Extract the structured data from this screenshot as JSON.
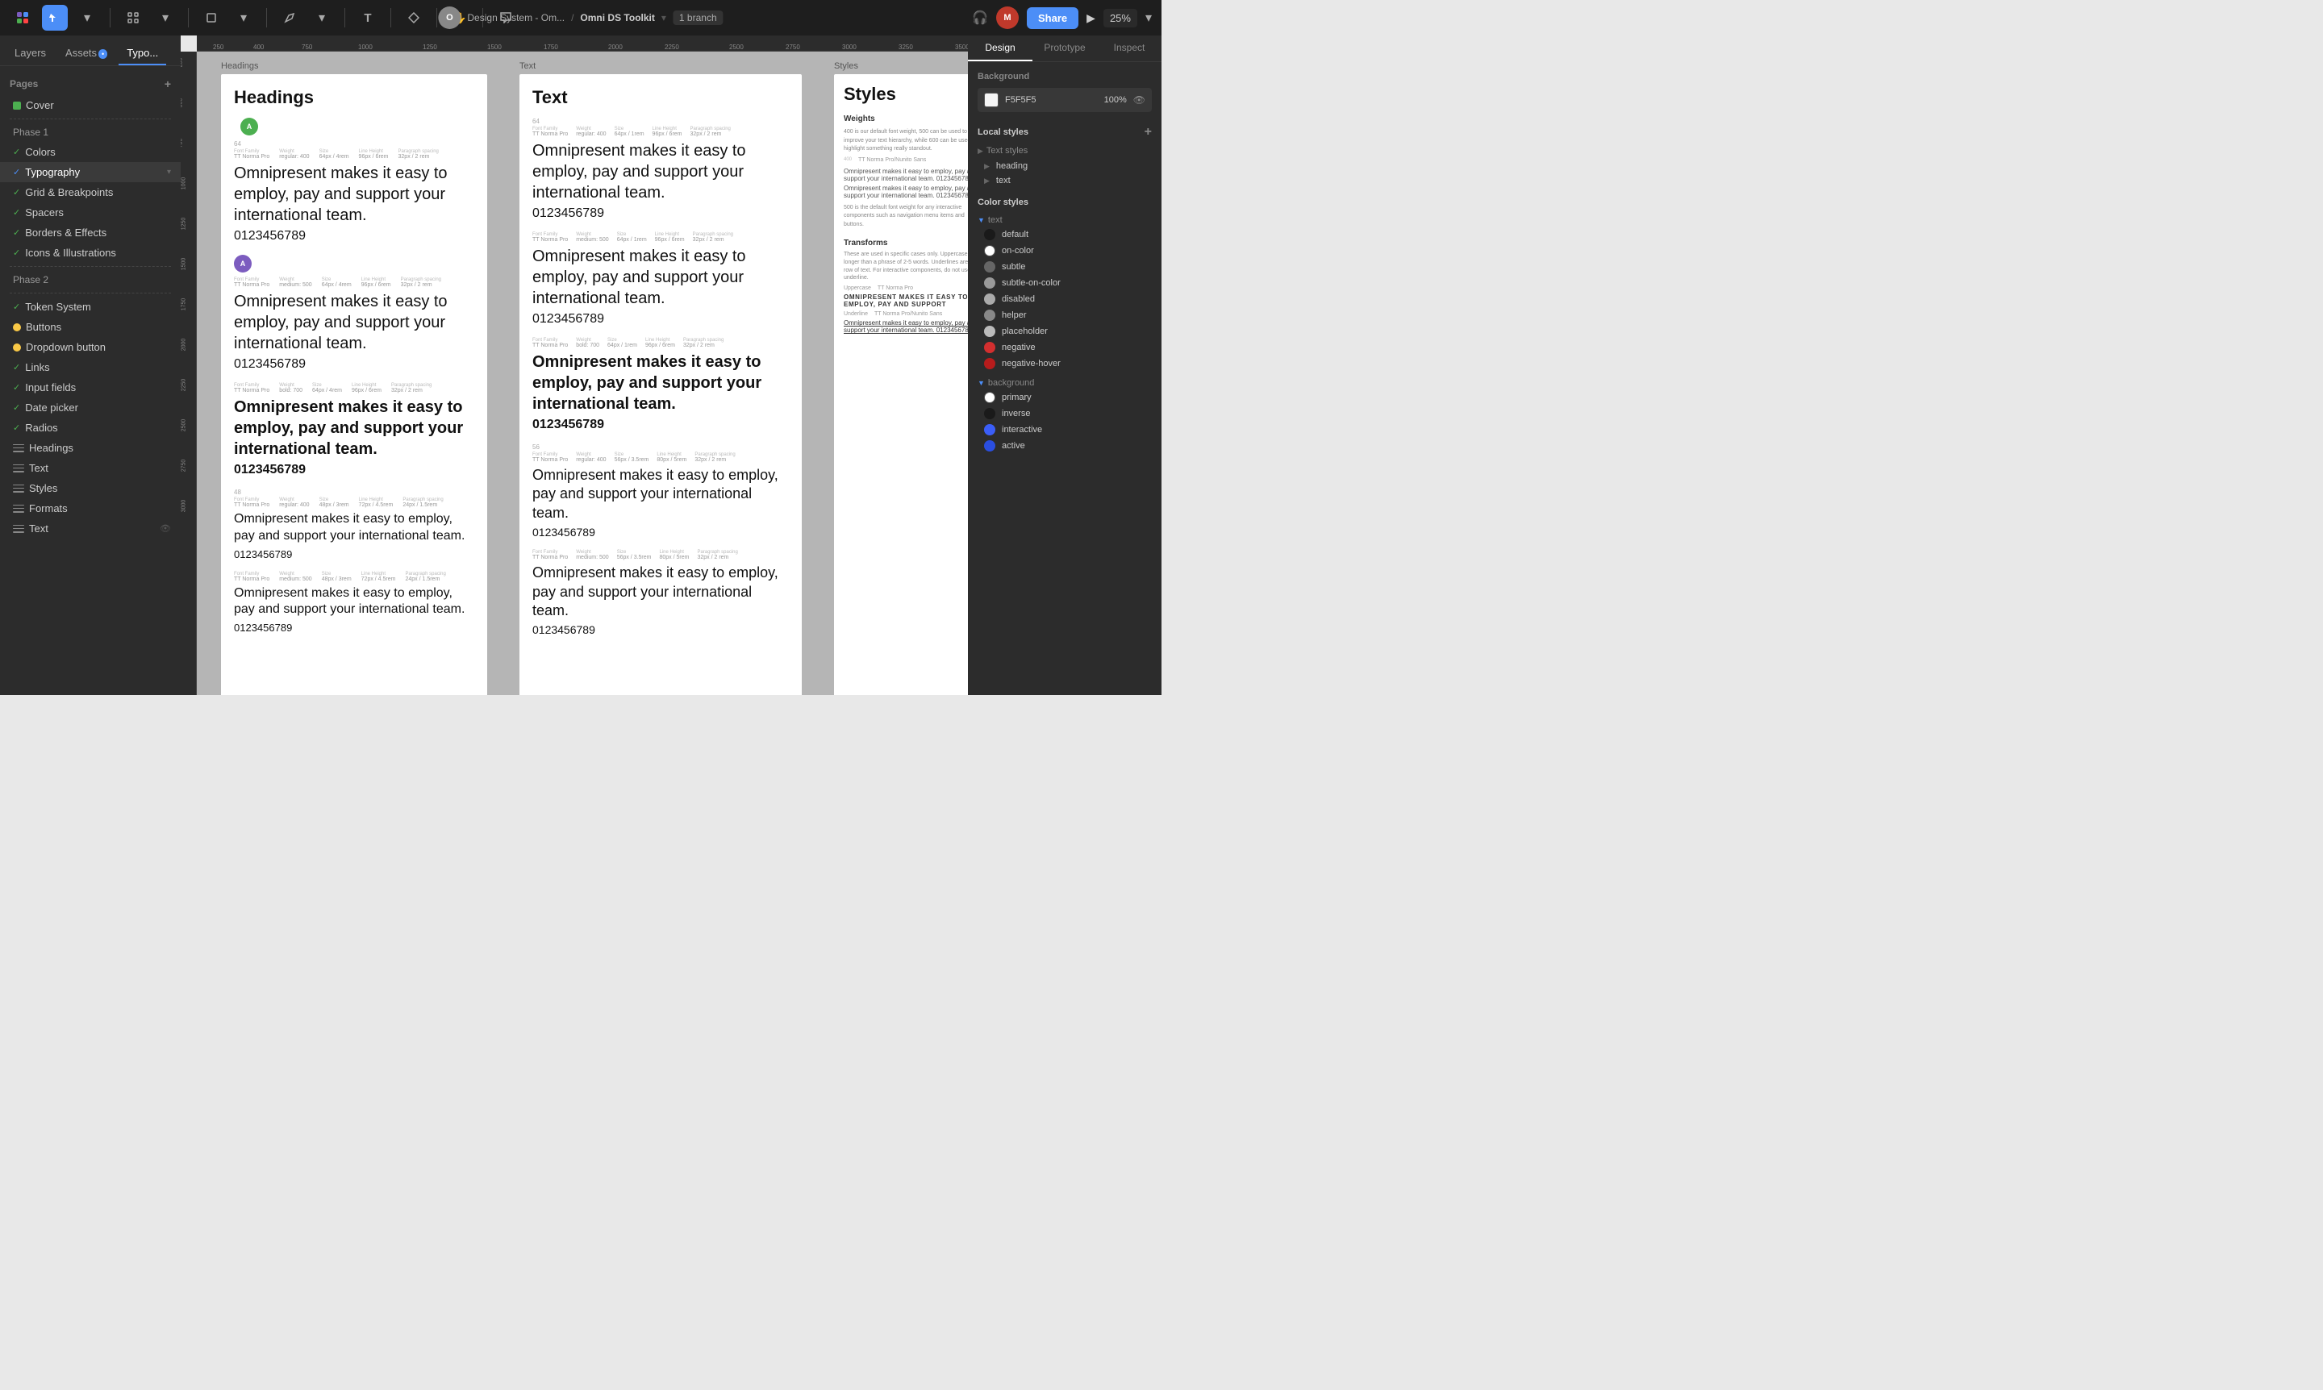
{
  "toolbar": {
    "project_name": "Design System - Om...",
    "full_name": "Omni DS Toolkit",
    "branch": "1 branch",
    "zoom": "25%",
    "share_label": "Share",
    "avatar_initials": "M"
  },
  "left_panel": {
    "tabs": [
      {
        "id": "layers",
        "label": "Layers",
        "active": false
      },
      {
        "id": "assets",
        "label": "Assets",
        "badge": true,
        "active": false
      },
      {
        "id": "typo",
        "label": "Typo...",
        "active": true
      }
    ],
    "pages_header": "Pages",
    "pages": [
      {
        "label": "Cover",
        "icon": "green-square",
        "type": "page"
      },
      {
        "label": "separator"
      },
      {
        "label": "Phase 1",
        "type": "group"
      },
      {
        "label": "Colors",
        "icon": "green-check",
        "type": "page"
      },
      {
        "label": "Typography",
        "icon": "green-check",
        "type": "page",
        "active": true,
        "expanded": true
      },
      {
        "label": "Grid & Breakpoints",
        "icon": "green-check",
        "type": "page"
      },
      {
        "label": "Spacers",
        "icon": "green-check",
        "type": "page"
      },
      {
        "label": "Borders & Effects",
        "icon": "green-check",
        "type": "page"
      },
      {
        "label": "Icons & Illustrations",
        "icon": "green-check",
        "type": "page"
      },
      {
        "label": "separator"
      },
      {
        "label": "Phase 2",
        "type": "group"
      },
      {
        "label": "separator"
      },
      {
        "label": "Token System",
        "icon": "green-check",
        "type": "page"
      },
      {
        "label": "Buttons",
        "icon": "yellow-dot",
        "type": "page"
      },
      {
        "label": "Dropdown button",
        "icon": "yellow-dot",
        "type": "page"
      },
      {
        "label": "Links",
        "icon": "green-check",
        "type": "page"
      },
      {
        "label": "Input fields",
        "icon": "green-check",
        "type": "page"
      },
      {
        "label": "Date picker",
        "icon": "green-check",
        "type": "page"
      },
      {
        "label": "Radios",
        "icon": "green-check",
        "type": "page"
      },
      {
        "label": "Headings",
        "icon": "hamburger",
        "type": "page"
      },
      {
        "label": "Text",
        "icon": "hamburger",
        "type": "page"
      },
      {
        "label": "Styles",
        "icon": "hamburger",
        "type": "page"
      },
      {
        "label": "Formats",
        "icon": "hamburger",
        "type": "page"
      },
      {
        "label": "Text",
        "icon": "hamburger",
        "type": "page",
        "bottom": true
      }
    ]
  },
  "canvas": {
    "frame_labels": {
      "headings": "Headings",
      "text": "Text",
      "styles": "Styles"
    },
    "headings_frame": {
      "title": "Headings",
      "samples": [
        {
          "size_label": "64",
          "meta": {
            "family": "TT Norma Pro",
            "weight": "regular: 400",
            "size": "64px / 4rem",
            "line_height": "96px / 6rem",
            "paragraph": "32px / 2 rem"
          },
          "text": "Omnipresent makes it easy to employ, pay and support your international team.",
          "number": "0123456789",
          "font_size": "large",
          "font_weight": "normal"
        },
        {
          "size_label": "",
          "meta": {
            "family": "TT Norma Pro",
            "weight": "medium: 500",
            "size": "64px / 4rem",
            "line_height": "96px / 6rem",
            "paragraph": "32px / 2 rem"
          },
          "text": "Omnipresent makes it easy to employ, pay and support your international team.",
          "number": "0123456789",
          "font_size": "large",
          "font_weight": "medium"
        },
        {
          "size_label": "",
          "meta": {
            "family": "TT Norma Pro",
            "weight": "bold: 700",
            "size": "64px / 4rem",
            "line_height": "96px / 6rem",
            "paragraph": "32px / 2 rem"
          },
          "text": "Omnipresent makes it easy to employ, pay and support your international team.",
          "number": "0123456789",
          "font_size": "large",
          "font_weight": "bold"
        },
        {
          "size_label": "48",
          "meta": {
            "family": "TT Norma Pro",
            "weight": "regular: 400",
            "size": "48px / 3rem",
            "line_height": "72px / 4.5rem",
            "paragraph": "24px / 1.5rem"
          },
          "text": "Omnipresent makes it easy to employ, pay and support your international team.",
          "number": "0123456789",
          "font_size": "medium",
          "font_weight": "normal"
        },
        {
          "size_label": "",
          "meta": {
            "family": "TT Norma Pro",
            "weight": "medium: 500",
            "size": "48px / 3rem",
            "line_height": "72px / 4.5rem",
            "paragraph": "24px / 1.5rem"
          },
          "text": "Omnipresent makes it easy to employ, pay and support your international team.",
          "number": "0123456789",
          "font_size": "medium",
          "font_weight": "medium"
        }
      ]
    },
    "text_frame": {
      "title": "Text",
      "samples": [
        {
          "size_label": "64",
          "meta": {
            "family": "TT Norma Pro",
            "weight": "regular: 400",
            "size": "64px / 1rem",
            "line_height": "96px / 6rem",
            "paragraph": "32px / 2 rem"
          },
          "text": "Omnipresent makes it easy to employ, pay and support your international team.",
          "number": "0123456789"
        },
        {
          "size_label": "",
          "meta": {
            "family": "TT Norma Pro",
            "weight": "medium: 500",
            "size": "64px / 1rem",
            "line_height": "96px / 6rem",
            "paragraph": "32px / 2 rem"
          },
          "text": "Omnipresent makes it easy to employ, pay and support your international team.",
          "number": "0123456789"
        },
        {
          "size_label": "",
          "meta": {
            "family": "TT Norma Pro",
            "weight": "bold: 700",
            "size": "64px / 1rem",
            "line_height": "96px / 6rem",
            "paragraph": "32px / 2 rem"
          },
          "text": "Omnipresent makes it easy to employ, pay and support your international team.",
          "number": "0123456789",
          "bold": true
        },
        {
          "size_label": "56",
          "meta": {
            "family": "TT Norma Pro",
            "weight": "regular: 400",
            "size": "56px / 3.5rem",
            "line_height": "80px / 5rem",
            "paragraph": "32px / 2 rem"
          },
          "text": "Omnipresent makes it easy to employ, pay and support your international team.",
          "number": "0123456789"
        },
        {
          "size_label": "",
          "meta": {
            "family": "TT Norma Pro",
            "weight": "medium: 500",
            "size": "56px / 3.5rem",
            "line_height": "80px / 5rem",
            "paragraph": "32px / 2 rem"
          },
          "text": "Omnipresent makes it easy to employ, pay and support your international team.",
          "number": "0123456789"
        }
      ]
    }
  },
  "right_panel": {
    "tabs": [
      "Design",
      "Prototype",
      "Inspect"
    ],
    "active_tab": "Design",
    "background": {
      "title": "Background",
      "color": "F5F5F5",
      "opacity": "100%"
    },
    "local_styles": {
      "title": "Local styles",
      "text_styles": {
        "title": "Text styles",
        "items": [
          "heading",
          "text"
        ]
      },
      "color_styles": {
        "title": "Color styles",
        "groups": [
          {
            "name": "text",
            "expanded": true,
            "items": [
              {
                "label": "default",
                "color": "#1a1a1a"
              },
              {
                "label": "on-color",
                "color": "#ffffff"
              },
              {
                "label": "subtle",
                "color": "#666666"
              },
              {
                "label": "subtle-on-color",
                "color": "#999999"
              },
              {
                "label": "disabled",
                "color": "#aaaaaa"
              },
              {
                "label": "helper",
                "color": "#888888"
              },
              {
                "label": "placeholder",
                "color": "#bbbbbb"
              },
              {
                "label": "negative",
                "color": "#d32f2f"
              },
              {
                "label": "negative-hover",
                "color": "#b71c1c"
              }
            ]
          },
          {
            "name": "background",
            "expanded": true,
            "items": [
              {
                "label": "primary",
                "color": "#ffffff"
              },
              {
                "label": "inverse",
                "color": "#1a1a1a"
              },
              {
                "label": "interactive",
                "color": "#3b5ef8"
              },
              {
                "label": "active",
                "color": "#2a4ee0"
              }
            ]
          }
        ]
      }
    }
  }
}
